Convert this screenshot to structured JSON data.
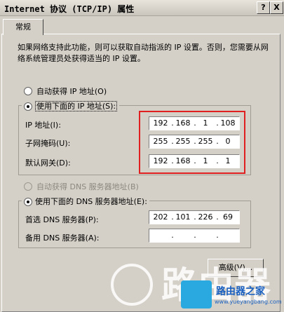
{
  "window": {
    "title": "Internet 协议 (TCP/IP) 属性",
    "help_button": "?",
    "close_button": "X"
  },
  "tabs": [
    {
      "label": "常规"
    }
  ],
  "info_text": "如果网络支持此功能，则可以获取自动指派的 IP 设置。否则，您需要从网络系统管理员处获得适当的 IP 设置。",
  "ip_section": {
    "auto_label": "自动获得 IP 地址(O)",
    "manual_label": "使用下面的 IP 地址(S):",
    "selected": "manual",
    "fields": [
      {
        "label": "IP 地址(I):",
        "octets": [
          "192",
          "168",
          "1",
          "108"
        ]
      },
      {
        "label": "子网掩码(U):",
        "octets": [
          "255",
          "255",
          "255",
          "0"
        ]
      },
      {
        "label": "默认网关(D):",
        "octets": [
          "192",
          "168",
          "1",
          "1"
        ]
      }
    ]
  },
  "dns_section": {
    "auto_label": "自动获得 DNS 服务器地址(B)",
    "manual_label": "使用下面的 DNS 服务器地址(E):",
    "selected": "manual",
    "fields": [
      {
        "label": "首选 DNS 服务器(P):",
        "octets": [
          "202",
          "101",
          "226",
          "69"
        ]
      },
      {
        "label": "备用 DNS 服务器(A):",
        "octets": [
          "",
          "",
          "",
          ""
        ]
      }
    ]
  },
  "advanced_button": "高级(V)...",
  "watermark": {
    "text": "路由器",
    "brand": "路由器之家",
    "url": "www.yueyangbang.com"
  },
  "colors": {
    "highlight_box": "#e02020",
    "dialog_bg": "#d4d0c8"
  }
}
